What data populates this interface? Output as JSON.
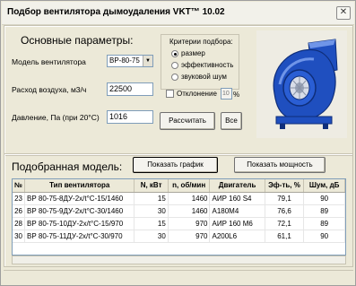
{
  "window": {
    "title": "Подбор вентилятора дымоудаления VKT™ 10.02",
    "close_glyph": "✕"
  },
  "params": {
    "section_title": "Основные параметры:",
    "model_label": "Модель вентилятора",
    "model_value": "ВР-80-75",
    "airflow_label": "Расход воздуха, м3/ч",
    "airflow_value": "22500",
    "pressure_label": "Давление, Па (при 20°С)",
    "pressure_value": "1016"
  },
  "criteria": {
    "title": "Критерии подбора:",
    "options": [
      {
        "label": "размер",
        "selected": true
      },
      {
        "label": "эффективность",
        "selected": false
      },
      {
        "label": "звуковой шум",
        "selected": false
      }
    ],
    "deviation_label": "Отклонение",
    "deviation_value": "10",
    "deviation_unit": "%"
  },
  "buttons": {
    "calculate": "Рассчитать",
    "all": "Все",
    "show_chart": "Показать график",
    "show_power": "Показать мощность"
  },
  "result": {
    "section_title": "Подобранная модель:",
    "columns": [
      "№",
      "Тип вентилятора",
      "N, кВт",
      "n, об/мин",
      "Двигатель",
      "Эф-ть, %",
      "Шум, дБ"
    ],
    "rows": [
      [
        "23",
        "ВР 80-75-8ДУ-2х/t°С-15/1460",
        "15",
        "1460",
        "АИР 160 S4",
        "79,1",
        "90"
      ],
      [
        "26",
        "ВР 80-75-9ДУ-2х/t°С-30/1460",
        "30",
        "1460",
        "А180М4",
        "76,6",
        "89"
      ],
      [
        "28",
        "ВР 80-75-10ДУ-2х/t°С-15/970",
        "15",
        "970",
        "АИР 160 М6",
        "72,1",
        "89"
      ],
      [
        "30",
        "ВР 80-75-11ДУ-2х/t°С-30/970",
        "30",
        "970",
        "А200L6",
        "61,1",
        "90"
      ]
    ]
  },
  "icons": {
    "fan": "centrifugal-fan-image",
    "dropdown": "chevron-down-icon"
  },
  "colors": {
    "window_bg": "#ece9d8",
    "fan_body": "#1f4fbf",
    "fan_shadow": "#0f2e7a",
    "fan_highlight": "#6f95e8"
  }
}
